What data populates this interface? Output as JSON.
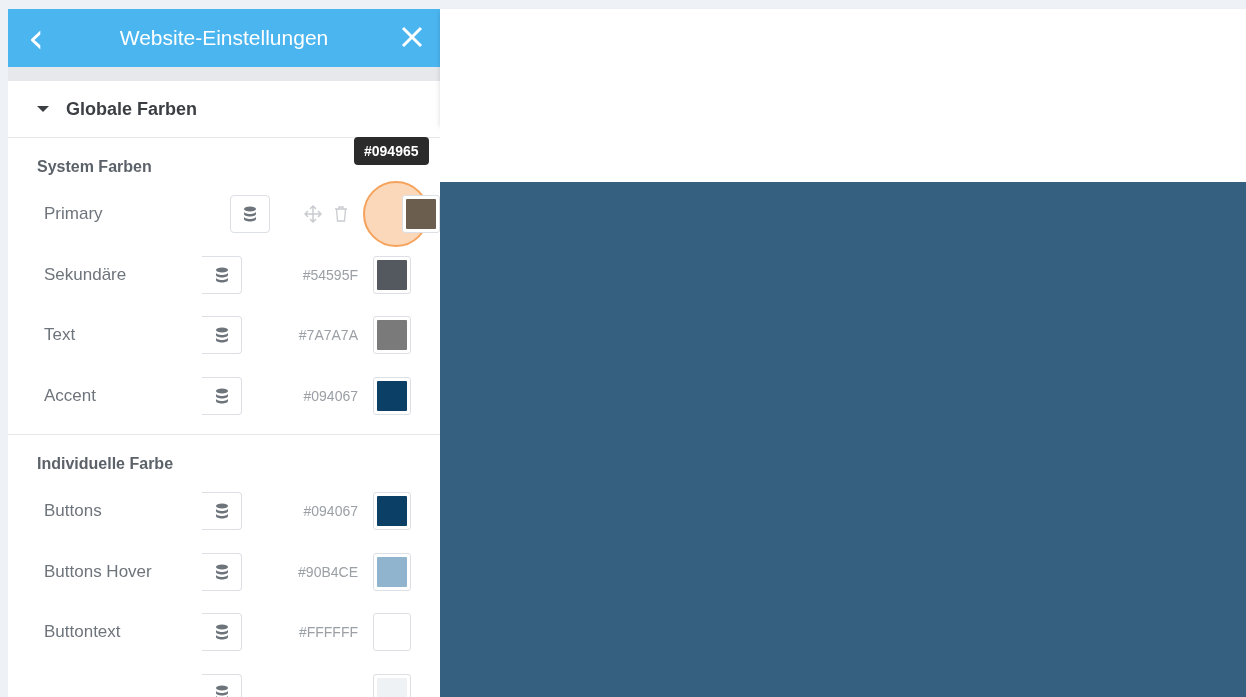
{
  "header": {
    "back_icon": "‹",
    "title": "Website-Einstellungen"
  },
  "section": {
    "title": "Globale Farben",
    "expanded": true
  },
  "groups": [
    {
      "title": "System Farben",
      "rows": [
        {
          "name": "Primary",
          "hovered": true,
          "color": "#6b5e4e",
          "tooltip": "#094965"
        },
        {
          "name": "Sekundäre",
          "hovered": false,
          "value": "#54595F",
          "color": "#54595f"
        },
        {
          "name": "Text",
          "hovered": false,
          "value": "#7A7A7A",
          "color": "#7a7a7a"
        },
        {
          "name": "Accent",
          "hovered": false,
          "value": "#094067",
          "color": "#0b3f66"
        }
      ]
    },
    {
      "title": "Individuelle Farbe",
      "rows": [
        {
          "name": "Buttons",
          "hovered": false,
          "value": "#094067",
          "color": "#0b3f66"
        },
        {
          "name": "Buttons Hover",
          "hovered": false,
          "value": "#90B4CE",
          "color": "#90b4ce"
        },
        {
          "name": "Buttontext",
          "hovered": false,
          "value": "#FFFFFF",
          "color": "#ffffff"
        },
        {
          "hovered": false,
          "color": "#eef2f5"
        }
      ]
    }
  ]
}
